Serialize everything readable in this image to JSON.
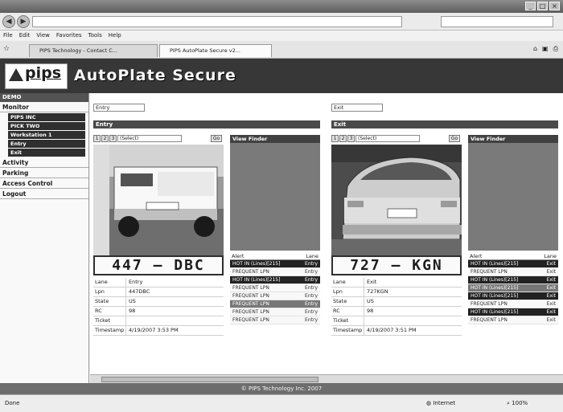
{
  "browser": {
    "back_icon": "back-arrow-icon",
    "forward_icon": "forward-arrow-icon",
    "menu": [
      "File",
      "Edit",
      "View",
      "Favorites",
      "Tools",
      "Help"
    ],
    "tabs": [
      "PIPS Technology - Contact C...",
      "PIPS AutoPlate Secure v2..."
    ],
    "status_left": "Done",
    "status_zone": "Internet",
    "status_zoom": "100%"
  },
  "app": {
    "logo_text": "pips",
    "title": "AutoPlate Secure"
  },
  "sidebar": {
    "demo_label": "DEMO",
    "monitor_label": "Monitor",
    "monitor_items": [
      "PIPS INC",
      "PICK TWO",
      "Workstation 1",
      "Entry",
      "Exit"
    ],
    "sections": [
      "Activity",
      "Parking",
      "Access Control",
      "Logout"
    ]
  },
  "lanes": [
    {
      "selector": "Entry",
      "header": "Entry",
      "pager": [
        "1",
        "2",
        "3"
      ],
      "camera_select": "(Select)",
      "go_label": "Go",
      "view_finder": "View Finder",
      "plate": "447 — DBC",
      "fields": [
        {
          "label": "Lane",
          "value": "Entry"
        },
        {
          "label": "Lpn",
          "value": "447DBC"
        },
        {
          "label": "State",
          "value": "US"
        },
        {
          "label": "RC",
          "value": "98"
        },
        {
          "label": "Ticket",
          "value": ""
        },
        {
          "label": "Timestamp",
          "value": "4/19/2007 3:53 PM"
        }
      ],
      "alerts_header": {
        "left": "Alert",
        "right": "Lane"
      },
      "alerts": [
        {
          "text": "HOT IN (Lines)[215]",
          "lane": "Entry",
          "style": "dark"
        },
        {
          "text": "FREQUENT LPN",
          "lane": "Entry",
          "style": "lite"
        },
        {
          "text": "HOT IN (Lines)[215]",
          "lane": "Entry",
          "style": "dark"
        },
        {
          "text": "FREQUENT LPN",
          "lane": "Entry",
          "style": "lite"
        },
        {
          "text": "FREQUENT LPN",
          "lane": "Entry",
          "style": "lite"
        },
        {
          "text": "FREQUENT LPN",
          "lane": "Entry",
          "style": "mid"
        },
        {
          "text": "FREQUENT LPN",
          "lane": "Entry",
          "style": "lite"
        },
        {
          "text": "FREQUENT LPN",
          "lane": "Entry",
          "style": "lite"
        }
      ]
    },
    {
      "selector": "Exit",
      "header": "Exit",
      "pager": [
        "1",
        "2",
        "3"
      ],
      "camera_select": "(Select)",
      "go_label": "Go",
      "view_finder": "View Finder",
      "plate": "727 — KGN",
      "fields": [
        {
          "label": "Lane",
          "value": "Exit"
        },
        {
          "label": "Lpn",
          "value": "727KGN"
        },
        {
          "label": "State",
          "value": "US"
        },
        {
          "label": "RC",
          "value": "98"
        },
        {
          "label": "Ticket",
          "value": ""
        },
        {
          "label": "Timestamp",
          "value": "4/19/2007 3:51 PM"
        }
      ],
      "alerts_header": {
        "left": "Alert",
        "right": "Lane"
      },
      "alerts": [
        {
          "text": "HOT IN (Lines)[215]",
          "lane": "Exit",
          "style": "dark"
        },
        {
          "text": "FREQUENT LPN",
          "lane": "Exit",
          "style": "lite"
        },
        {
          "text": "HOT IN (Lines)[215]",
          "lane": "Exit",
          "style": "dark"
        },
        {
          "text": "HOT IN (Lines)[215]",
          "lane": "Exit",
          "style": "mid"
        },
        {
          "text": "HOT IN (Lines)[215]",
          "lane": "Exit",
          "style": "dark"
        },
        {
          "text": "FREQUENT LPN",
          "lane": "Exit",
          "style": "lite"
        },
        {
          "text": "HOT IN (Lines)[215]",
          "lane": "Exit",
          "style": "dark"
        },
        {
          "text": "FREQUENT LPN",
          "lane": "Exit",
          "style": "lite"
        }
      ]
    }
  ],
  "footer": "© PIPS Technology Inc. 2007"
}
